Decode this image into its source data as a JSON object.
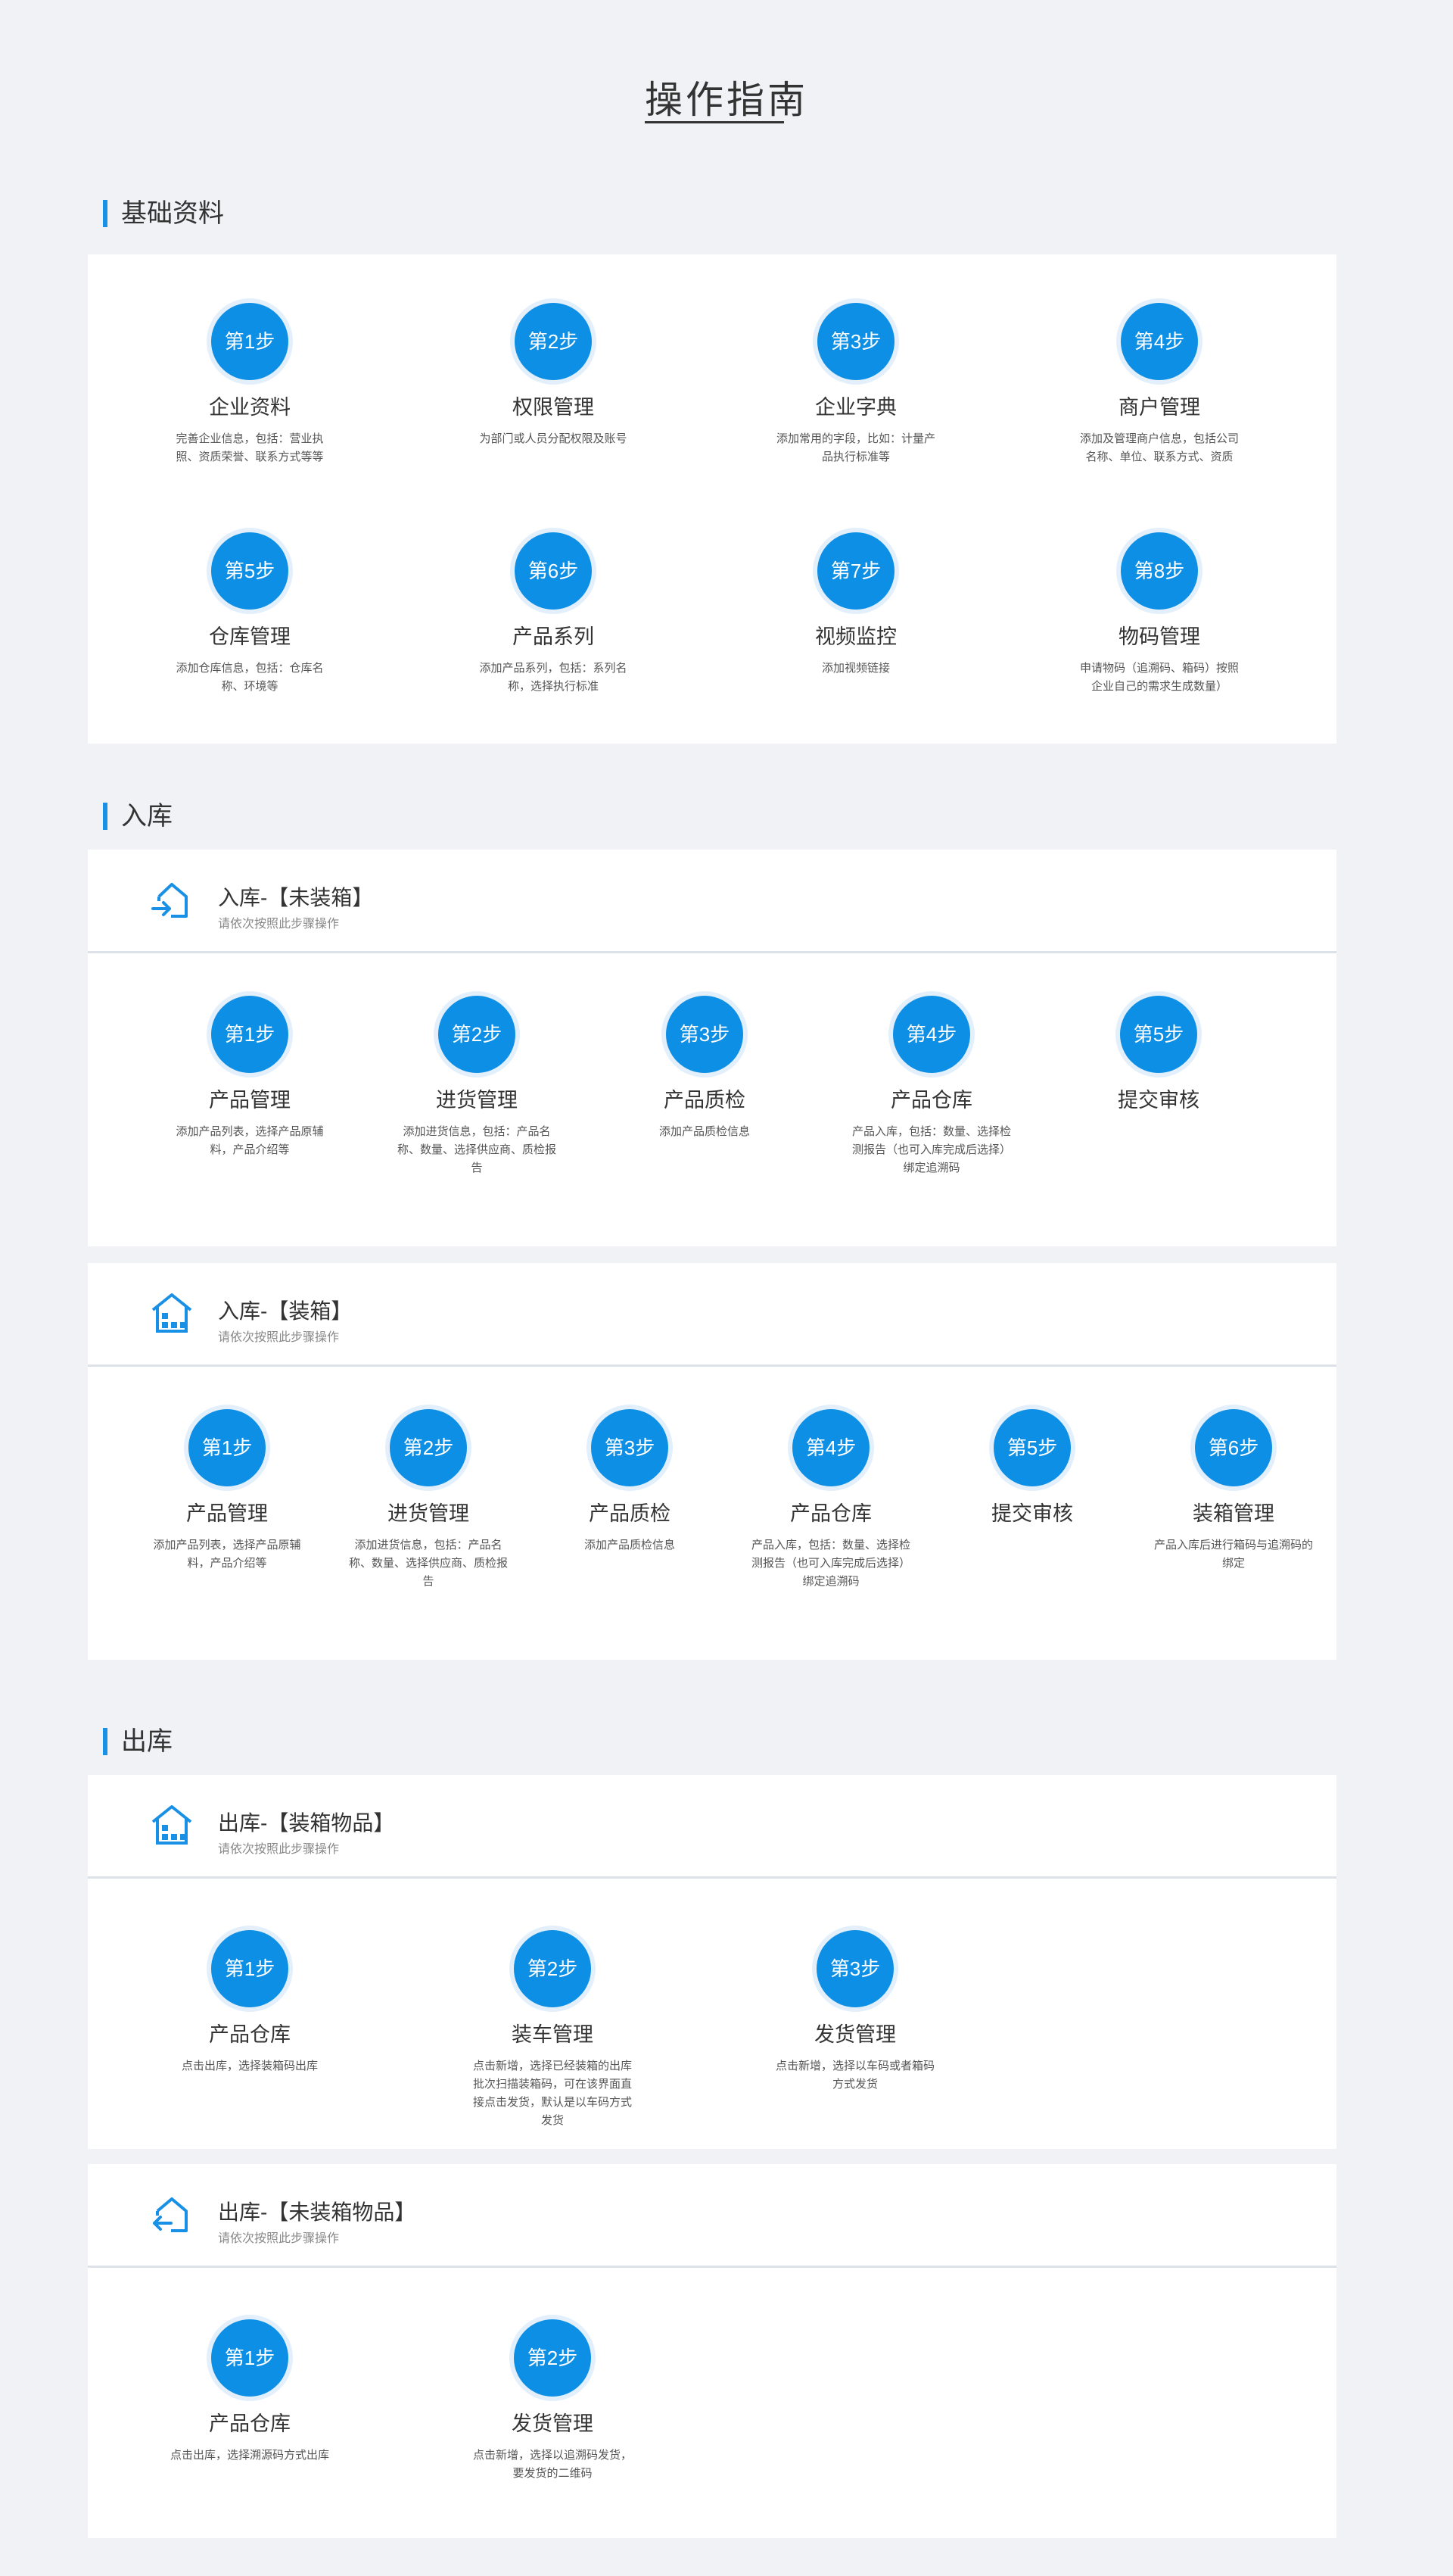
{
  "page": {
    "title": "操作指南"
  },
  "sections": {
    "basic": {
      "label": "基础资料"
    },
    "inbound": {
      "label": "入库"
    },
    "outbound": {
      "label": "出库"
    }
  },
  "colors": {
    "accent": "#0e8fe6",
    "page_bg": "#f0f2f5",
    "card_bg": "#ffffff"
  },
  "basic_steps": [
    {
      "badge": "第1步",
      "name": "企业资料",
      "desc": "完善企业信息，包括：营业执照、资质荣誉、联系方式等等"
    },
    {
      "badge": "第2步",
      "name": "权限管理",
      "desc": "为部门或人员分配权限及账号"
    },
    {
      "badge": "第3步",
      "name": "企业字典",
      "desc": "添加常用的字段，比如：计量产品执行标准等"
    },
    {
      "badge": "第4步",
      "name": "商户管理",
      "desc": "添加及管理商户信息，包括公司名称、单位、联系方式、资质"
    },
    {
      "badge": "第5步",
      "name": "仓库管理",
      "desc": "添加仓库信息，包括：仓库名称、环境等"
    },
    {
      "badge": "第6步",
      "name": "产品系列",
      "desc": "添加产品系列，包括：系列名称，选择执行标准"
    },
    {
      "badge": "第7步",
      "name": "视频监控",
      "desc": "添加视频链接"
    },
    {
      "badge": "第8步",
      "name": "物码管理",
      "desc": "申请物码（追溯码、箱码）按照企业自己的需求生成数量）"
    }
  ],
  "inbound_unboxed": {
    "title": "入库-【未装箱】",
    "subtitle": "请依次按照此步骤操作",
    "icon": "enter-house-icon",
    "steps": [
      {
        "badge": "第1步",
        "name": "产品管理",
        "desc": "添加产品列表，选择产品原辅料，产品介绍等"
      },
      {
        "badge": "第2步",
        "name": "进货管理",
        "desc": "添加进货信息，包括：产品名称、数量、选择供应商、质检报告"
      },
      {
        "badge": "第3步",
        "name": "产品质检",
        "desc": "添加产品质检信息"
      },
      {
        "badge": "第4步",
        "name": "产品仓库",
        "desc": "产品入库，包括：数量、选择检测报告（也可入库完成后选择）绑定追溯码"
      },
      {
        "badge": "第5步",
        "name": "提交审核",
        "desc": ""
      }
    ]
  },
  "inbound_boxed": {
    "title": "入库-【装箱】",
    "subtitle": "请依次按照此步骤操作",
    "icon": "boxed-house-icon",
    "steps": [
      {
        "badge": "第1步",
        "name": "产品管理",
        "desc": "添加产品列表，选择产品原辅料，产品介绍等"
      },
      {
        "badge": "第2步",
        "name": "进货管理",
        "desc": "添加进货信息，包括：产品名称、数量、选择供应商、质检报告"
      },
      {
        "badge": "第3步",
        "name": "产品质检",
        "desc": "添加产品质检信息"
      },
      {
        "badge": "第4步",
        "name": "产品仓库",
        "desc": "产品入库，包括：数量、选择检测报告（也可入库完成后选择）绑定追溯码"
      },
      {
        "badge": "第5步",
        "name": "提交审核",
        "desc": ""
      },
      {
        "badge": "第6步",
        "name": "装箱管理",
        "desc": "产品入库后进行箱码与追溯码的绑定"
      }
    ]
  },
  "outbound_boxed": {
    "title": "出库-【装箱物品】",
    "subtitle": "请依次按照此步骤操作",
    "icon": "boxed-house-icon",
    "steps": [
      {
        "badge": "第1步",
        "name": "产品仓库",
        "desc": "点击出库，选择装箱码出库"
      },
      {
        "badge": "第2步",
        "name": "装车管理",
        "desc": "点击新增，选择已经装箱的出库批次扫描装箱码，可在该界面直接点击发货，默认是以车码方式发货"
      },
      {
        "badge": "第3步",
        "name": "发货管理",
        "desc": "点击新增，选择以车码或者箱码方式发货"
      }
    ]
  },
  "outbound_unboxed": {
    "title": "出库-【未装箱物品】",
    "subtitle": "请依次按照此步骤操作",
    "icon": "exit-house-icon",
    "steps": [
      {
        "badge": "第1步",
        "name": "产品仓库",
        "desc": "点击出库，选择溯源码方式出库"
      },
      {
        "badge": "第2步",
        "name": "发货管理",
        "desc": "点击新增，选择以追溯码发货，要发货的二维码"
      }
    ]
  }
}
